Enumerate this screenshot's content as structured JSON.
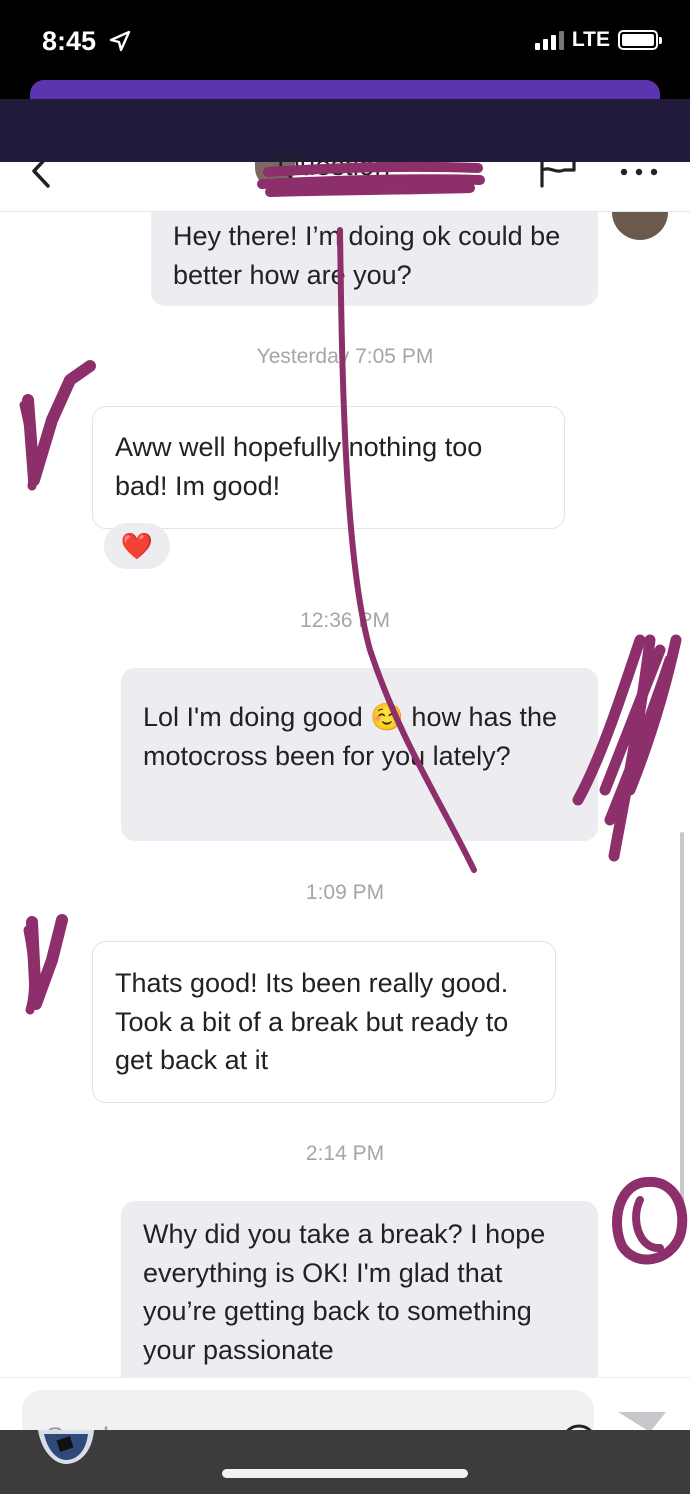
{
  "status_bar": {
    "time": "8:45",
    "network": "LTE",
    "location_icon": "location-arrow-icon",
    "battery_icon": "battery-full-icon",
    "signal_icon": "signal-bars-icon"
  },
  "header": {
    "back_icon": "chevron-left-icon",
    "name": "Question",
    "flag_icon": "flag-icon",
    "more_icon": "more-dots-icon"
  },
  "messages": [
    {
      "side": "sent",
      "text": "Hey there! I’m doing ok could be better how are you?"
    },
    {
      "side": "stamp",
      "text": "Yesterday 7:05 PM"
    },
    {
      "side": "received",
      "text": "Aww well hopefully nothing too bad! Im good!"
    },
    {
      "side": "reaction",
      "text": "❤️"
    },
    {
      "side": "stamp",
      "text": "12:36 PM"
    },
    {
      "side": "sent",
      "text": "Lol I'm doing good ☺️ how has the motocross been for you lately?"
    },
    {
      "side": "stamp",
      "text": "1:09 PM"
    },
    {
      "side": "received",
      "text": "Thats good! Its been really good. Took a bit of a break but ready to get back at it"
    },
    {
      "side": "stamp",
      "text": "2:14 PM"
    },
    {
      "side": "sent",
      "text": "Why did you take a break? I hope everything is OK! I'm glad that you’re getting back to something your passionate"
    }
  ],
  "composer": {
    "placeholder": "Send a message...",
    "emoji_icon": "emoji-smile-icon",
    "send_icon": "send-paper-plane-icon"
  },
  "colors": {
    "sent_bubble": "#ededf1",
    "received_border": "#e3e3e7",
    "timestamp": "#a5a5aa",
    "banner": "#5b34b0",
    "banner_dark": "#221a3b",
    "scribble": "#8c2f6b"
  }
}
